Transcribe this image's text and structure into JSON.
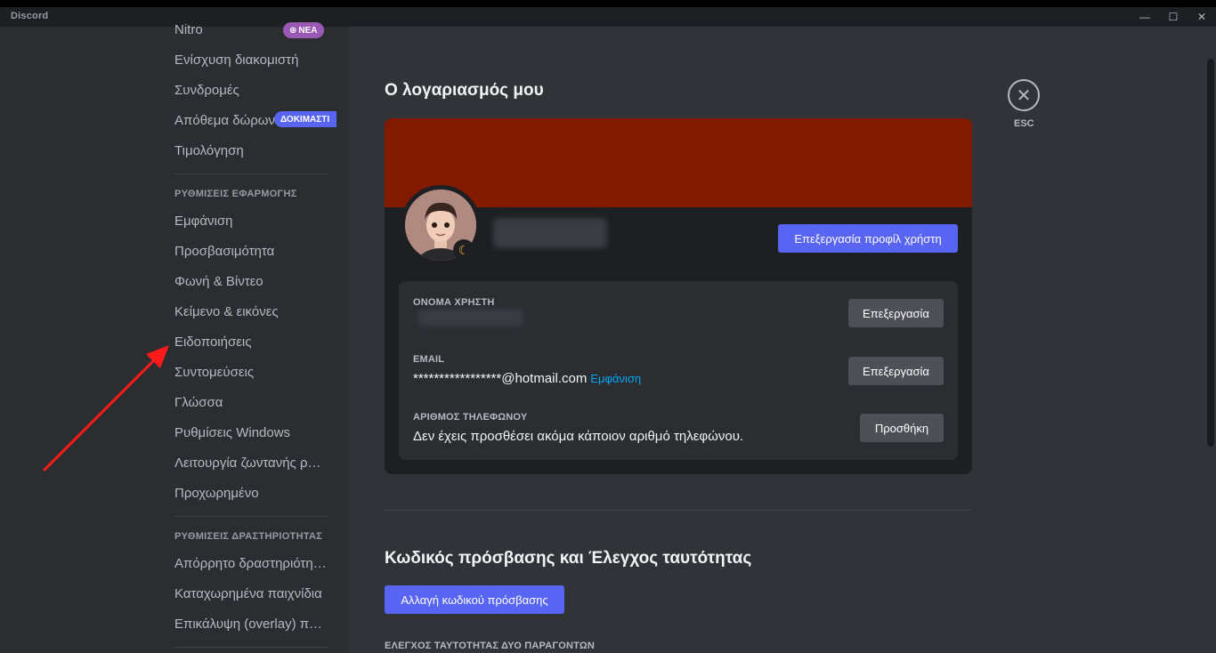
{
  "app": {
    "title": "Discord"
  },
  "window_controls": {
    "minimize": "—",
    "maximize": "☐",
    "close": "✕"
  },
  "sidebar": {
    "items_top": [
      {
        "label": "Nitro",
        "badge": "ΝΕΑ"
      },
      {
        "label": "Ενίσχυση διακομιστή"
      },
      {
        "label": "Συνδρομές"
      },
      {
        "label": "Απόθεμα δώρων",
        "badge": "ΔΟΚΙΜΑΣΤΙ"
      },
      {
        "label": "Τιμολόγηση"
      }
    ],
    "app_settings_header": "ΡΥΘΜΙΣΕΙΣ ΕΦΑΡΜΟΓΗΣ",
    "app_settings": [
      "Εμφάνιση",
      "Προσβασιμότητα",
      "Φωνή & Βίντεο",
      "Κείμενο & εικόνες",
      "Ειδοποιήσεις",
      "Συντομεύσεις",
      "Γλώσσα",
      "Ρυθμίσεις Windows",
      "Λειτουργία ζωντανής ροής",
      "Προχωρημένο"
    ],
    "activity_header": "ΡΥΘΜΙΣΕΙΣ ΔΡΑΣΤΗΡΙΟΤΗΤΑΣ",
    "activity_settings": [
      "Απόρρητο δραστηριότητας",
      "Καταχωρημένα παιχνίδια",
      "Επικάλυψη (overlay) παιχνιδιού"
    ]
  },
  "main": {
    "title": "Ο λογαριασμός μου",
    "close_label": "ESC",
    "close_glyph": "✕",
    "status_glyph": "☾",
    "edit_profile_button": "Επεξεργασία προφίλ χρήστη",
    "fields": {
      "username": {
        "label": "ΟΝΟΜΑ ΧΡΗΣΤΗ",
        "button": "Επεξεργασία"
      },
      "email": {
        "label": "EMAIL",
        "value": "*****************@hotmail.com",
        "reveal": "Εμφάνιση",
        "button": "Επεξεργασία"
      },
      "phone": {
        "label": "ΑΡΙΘΜΟΣ ΤΗΛΕΦΩΝΟΥ",
        "value": "Δεν έχεις προσθέσει ακόμα κάποιον αριθμό τηλεφώνου.",
        "button": "Προσθήκη"
      }
    },
    "password_section": {
      "title": "Κωδικός πρόσβασης και Έλεγχος ταυτότητας",
      "change_button": "Αλλαγή κωδικού πρόσβασης",
      "twofa_label": "ΕΛΕΓΧΟΣ ΤΑΥΤΟΤΗΤΑΣ ΔΥΟ ΠΑΡΑΓΟΝΤΩΝ"
    }
  },
  "colors": {
    "banner": "#821a00",
    "accent": "#5865f2",
    "annotation_arrow": "#ff1a1a"
  }
}
